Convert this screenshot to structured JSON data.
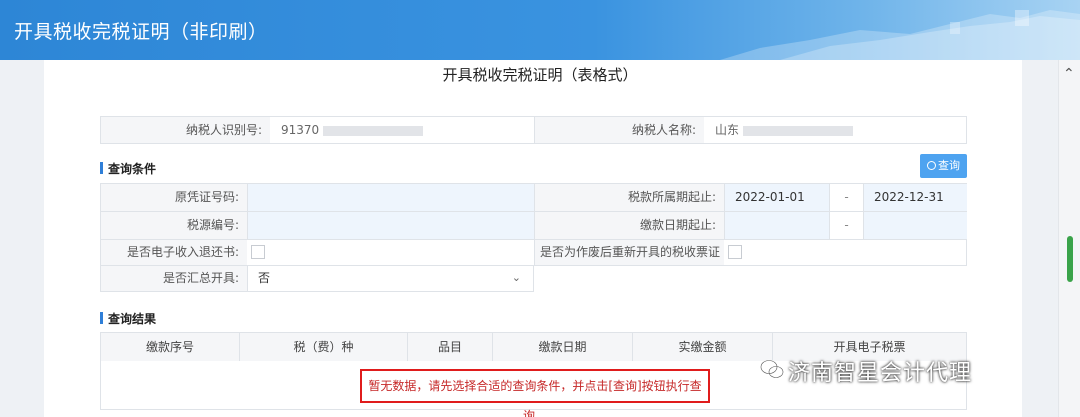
{
  "header": {
    "title": "开具税收完税证明（非印刷）"
  },
  "page": {
    "title": "开具税收完税证明（表格式）"
  },
  "taxpayer": {
    "id_label": "纳税人识别号:",
    "id_value": "91370",
    "name_label": "纳税人名称:",
    "name_value": "山东"
  },
  "query": {
    "section_title": "查询条件",
    "search_button": "查询",
    "original_cert_label": "原凭证号码:",
    "tax_period_label": "税款所属期起止:",
    "tax_period_start": "2022-01-01",
    "tax_period_sep": "-",
    "tax_period_end": "2022-12-31",
    "tax_source_label": "税源编号:",
    "payment_date_label": "缴款日期起止:",
    "payment_date_sep": "-",
    "e_refund_label": "是否电子收入退还书:",
    "reissue_label": "是否为作废后重新开具的税收票证",
    "summary_label": "是否汇总开具:",
    "summary_value": "否"
  },
  "results": {
    "section_title": "查询结果",
    "columns": [
      "缴款序号",
      "税（费）种",
      "品目",
      "缴款日期",
      "实缴金额",
      "开具电子税票"
    ],
    "empty_message": "暂无数据，请先选择合适的查询条件，并点击[查询]按钮执行查询。"
  },
  "watermark": {
    "text": "济南智星会计代理"
  }
}
